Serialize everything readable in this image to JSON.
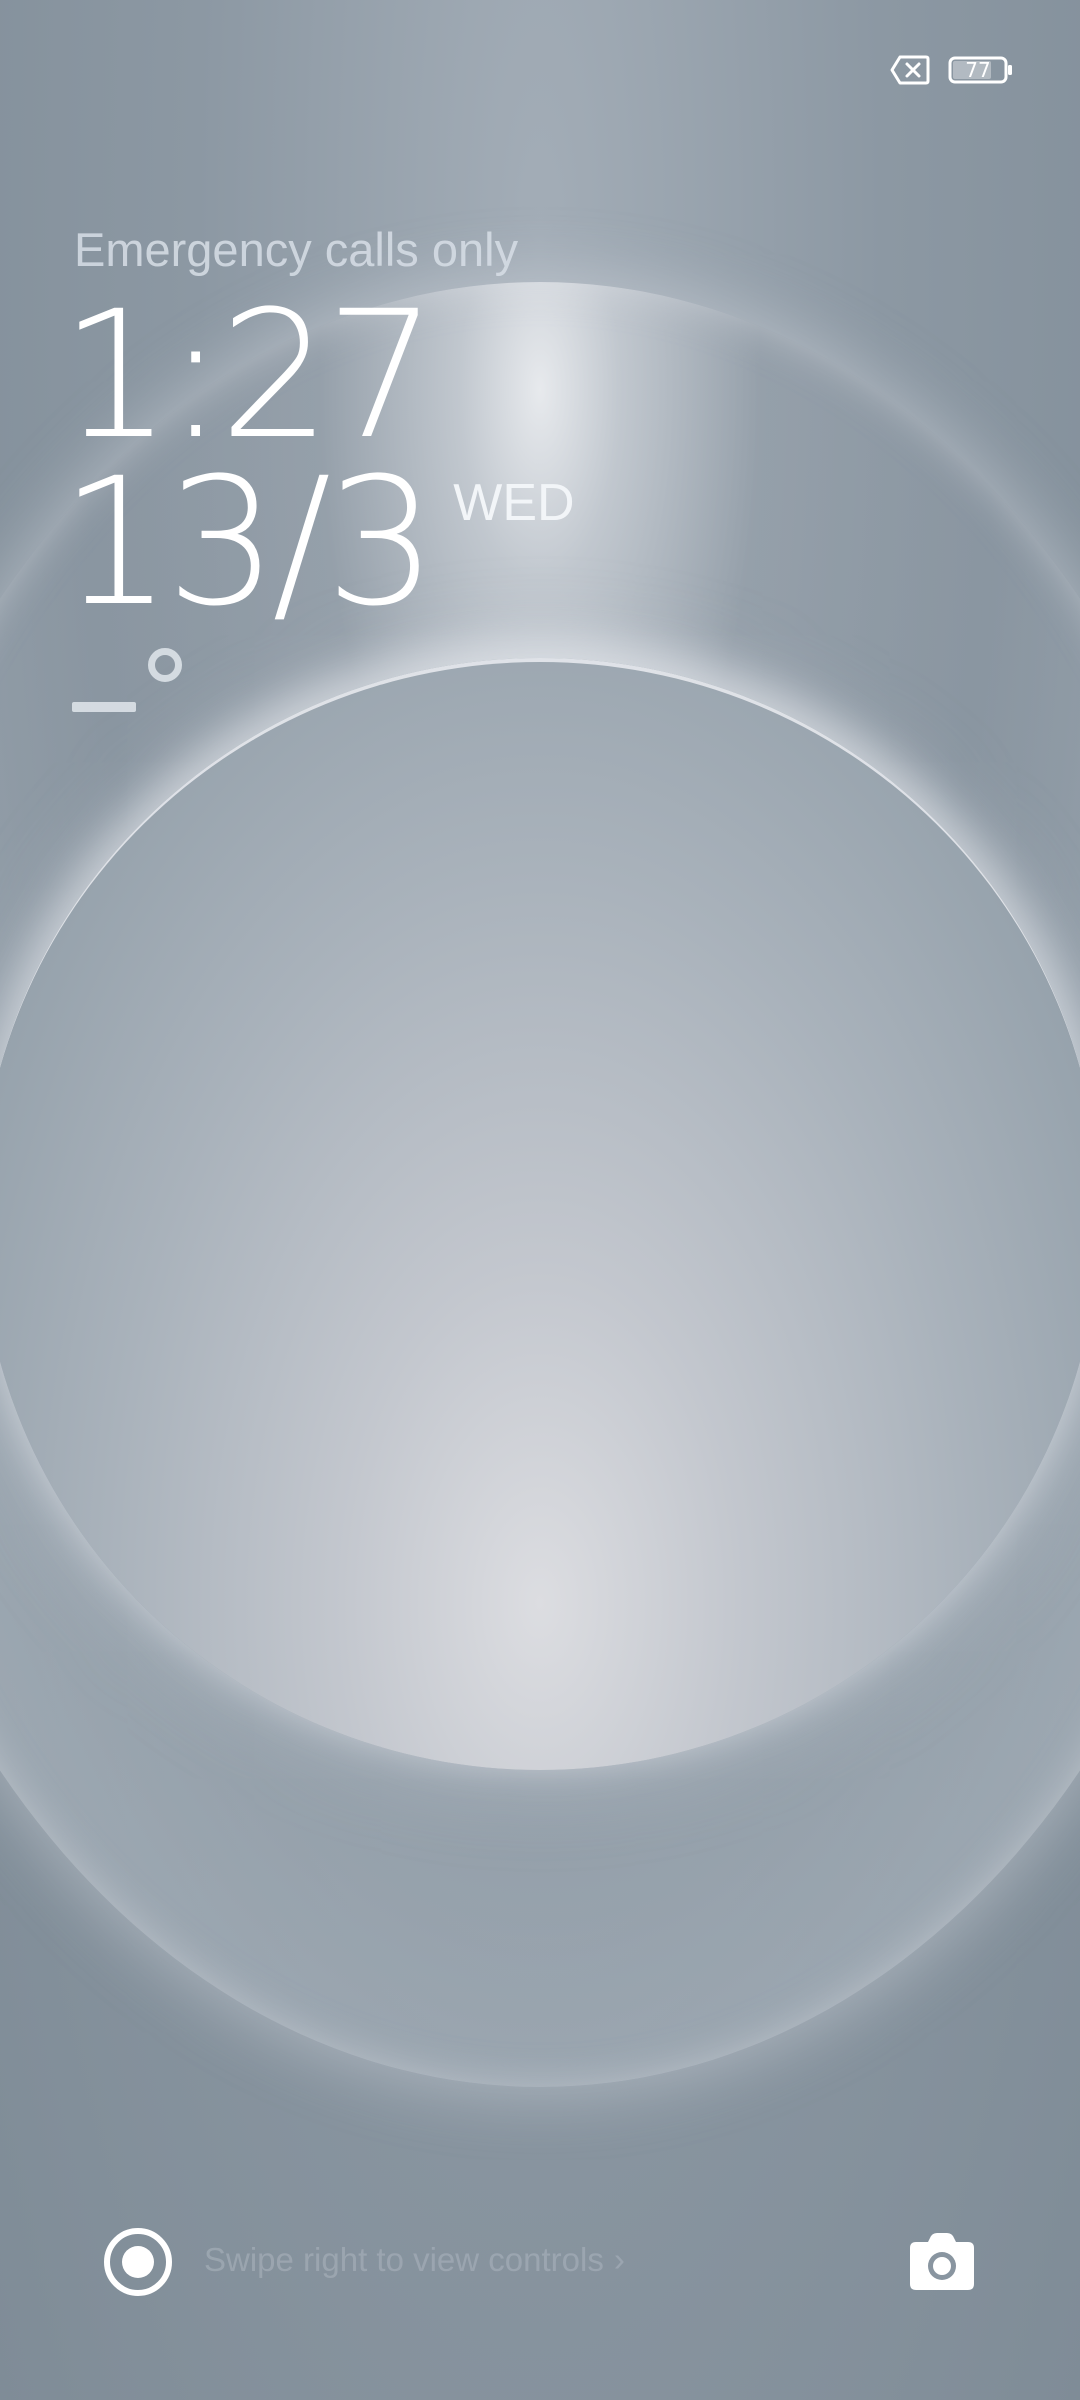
{
  "status_bar": {
    "sim_icon": "no-sim-icon",
    "battery_level": "77"
  },
  "lock_screen": {
    "carrier_text": "Emergency calls only",
    "time": "1:27",
    "date": "13/3",
    "weekday": "WED",
    "weather_icon": "temperature-placeholder-icon"
  },
  "bottom_bar": {
    "controls_icon": "record-circle-icon",
    "swipe_hint": "Swipe right to view controls",
    "swipe_hint_chevron": "›",
    "camera_icon": "camera-icon"
  },
  "colors": {
    "background": "#8995a0",
    "text_primary": "#ffffff"
  }
}
